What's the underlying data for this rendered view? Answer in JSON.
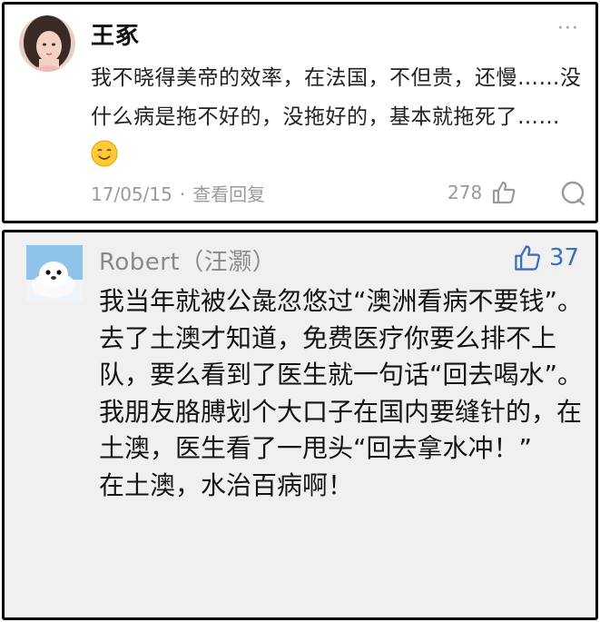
{
  "comment1": {
    "username": "王豖",
    "more_label": "···",
    "text": "我不晓得美帝的效率，在法国，不但贵，还慢……没什么病是拖不好的，没拖好的，基本就拖死了……",
    "emoji": "smiling-face-emoji",
    "date": "17/05/15",
    "separator": "·",
    "view_replies": "查看回复",
    "like_count": "278"
  },
  "comment2": {
    "username": "Robert（汪灏）",
    "like_count": "37",
    "text": "我当年就被公彘忽悠过“澳洲看病不要钱”。去了土澳才知道，免费医疗你要么排不上队，要么看到了医生就一句话“回去喝水”。\n我朋友胳膊划个大口子在国内要缝针的，在土澳，医生看了一甩头“回去拿水冲！”\n在土澳，水治百病啊！",
    "accent_color": "#3b6fc4"
  }
}
